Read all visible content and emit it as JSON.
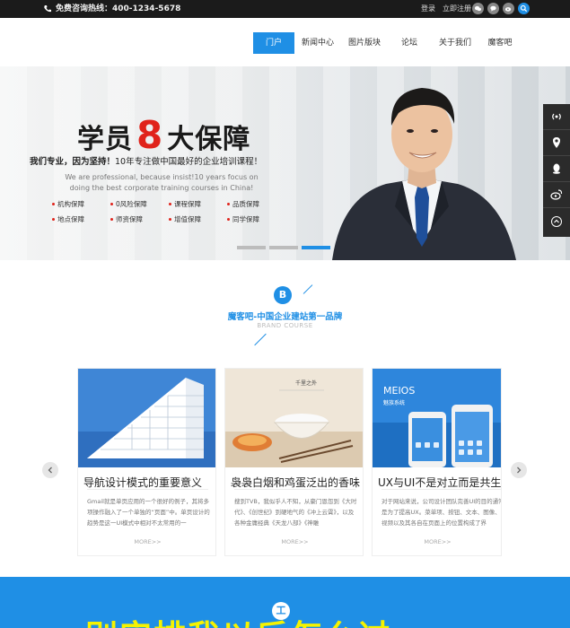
{
  "topbar": {
    "hotline": "免费咨询热线：400-1234-5678",
    "login": "登录",
    "register": "立即注册"
  },
  "nav": {
    "items": [
      "门户",
      "新闻中心",
      "图片版块",
      "论坛",
      "关于我们",
      "魔客吧"
    ],
    "active_index": 0
  },
  "banner": {
    "headline_pre": "学员",
    "headline_num": "8",
    "headline_post": "大保障",
    "subline_bold": "我们专业，因为坚持！",
    "subline_rest": "10年专注做中国最好的企业培训课程！",
    "english": "We are professional, because insist!10 years focus on doing the best corporate training courses in China!",
    "features": [
      "机构保障",
      "0风险保障",
      "课程保障",
      "品质保障",
      "地点保障",
      "师资保障",
      "增值保障",
      "同学保障"
    ],
    "active_slide": 2
  },
  "section": {
    "badge": "B",
    "title": "魔客吧-中国企业建站第一品牌",
    "subtitle": "BRAND COURSE"
  },
  "cards": [
    {
      "title": "导航设计模式的重要意义",
      "desc": "Gmail就是单页应用的一个很好的例子，其将多项操作融入了一个单独的“页面”中。单页设计的趋势是这一UI模式中相对不太常用的一",
      "more": "MORE>>"
    },
    {
      "title": "袅袅白烟和鸡蛋泛出的香味",
      "desc": "搜到TVB，我似乎人不知，从豪门恩怨到《大时代》、《创世纪》到硬地气的《冲上云霄》，以及各种金庸经典《天龙八部》《神雕",
      "more": "MORE>>",
      "image_text": "千里之外"
    },
    {
      "title": "UX与UI不是对立而是共生",
      "desc": "对于网站来说，公司设计团队完善UI的目的通常是为了提高UX。菜单项、按钮、文本、图像、视频以及其各自在页面上的位置构成了界",
      "more": "MORE>>",
      "image_text_1": "MEIOS",
      "image_text_2": "魅族系统"
    }
  ],
  "band": {
    "icon": "工",
    "text": "别实排我以后怎么过"
  },
  "colors": {
    "accent": "#1f8fe5",
    "topbar": "#1b1b1b",
    "red": "#e0231b",
    "yellow": "#f6f300"
  }
}
